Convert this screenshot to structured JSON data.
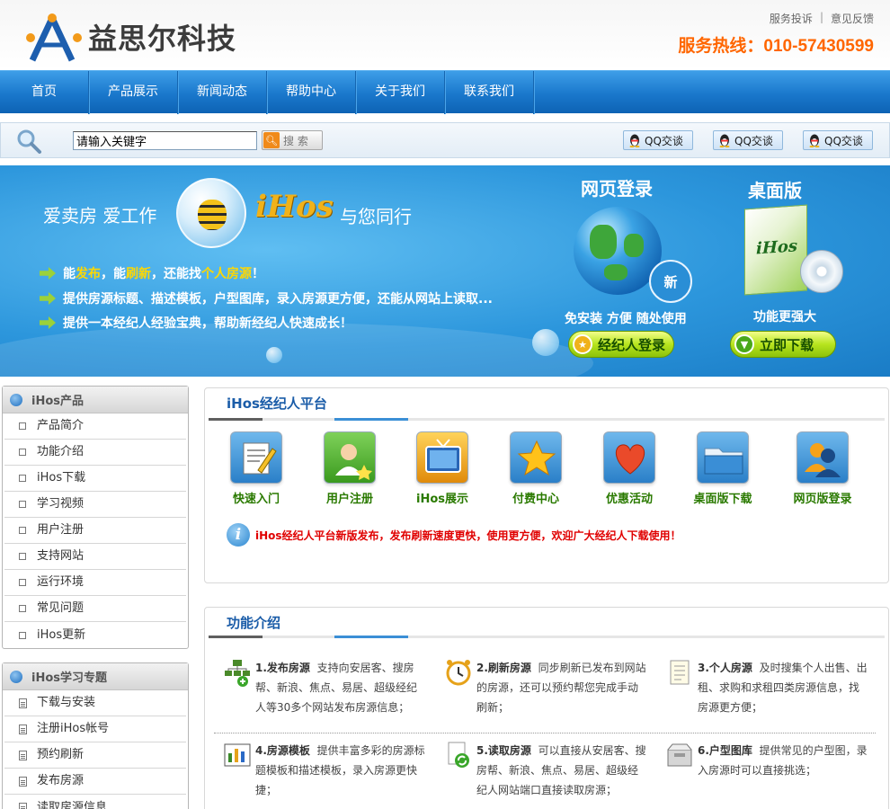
{
  "header": {
    "logo_text": "益思尔科技",
    "top_links": [
      "服务投诉",
      "意见反馈"
    ],
    "top_links_sep": "|",
    "hotline": "服务热线：010-57430599"
  },
  "nav": {
    "items": [
      "首页",
      "产品展示",
      "新闻动态",
      "帮助中心",
      "关于我们",
      "联系我们"
    ]
  },
  "search": {
    "value": "请输入关键字",
    "button_label": "搜 索",
    "qq_buttons": [
      "QQ交谈",
      "QQ交谈",
      "QQ交谈"
    ]
  },
  "banner": {
    "slogan_left": "爱卖房 爱工作",
    "brand": "iHos",
    "slogan_right": "与您同行",
    "feature_1": {
      "p1": "能",
      "h1": "发布",
      "p2": "，能",
      "h2": "刷新",
      "p3": "，还能找",
      "h3": "个人房源",
      "p4": "！"
    },
    "feature_2": "提供房源标题、描述模板，户型图库，录入房源更方便，还能从网站上读取...",
    "feature_3": "提供一本经纪人经验宝典，帮助新经纪人快速成长！",
    "web_title": "网页登录",
    "web_badge": "新",
    "web_sub": "免安装  方便  随处使用",
    "web_button": "经纪人登录",
    "desktop_title": "桌面版",
    "desktop_box_label": "iHos",
    "desktop_sub": "功能更强大",
    "desktop_button": "立即下载"
  },
  "sidebar": {
    "products": {
      "title": "iHos产品",
      "items": [
        "产品简介",
        "功能介绍",
        "iHos下载",
        "学习视频",
        "用户注册",
        "支持网站",
        "运行环境",
        "常见问题",
        "iHos更新"
      ]
    },
    "topics": {
      "title": "iHos学习专题",
      "items": [
        "下载与安装",
        "注册iHos帐号",
        "预约刷新",
        "发布房源",
        "读取房源信息"
      ]
    }
  },
  "platform": {
    "title": "iHos经纪人平台",
    "apps": [
      {
        "label": "快速入门",
        "icon": "notepad-pencil-icon",
        "color": "#3f9ad8"
      },
      {
        "label": "用户注册",
        "icon": "user-register-icon",
        "color": "#4cae2e"
      },
      {
        "label": "iHos展示",
        "icon": "tv-icon",
        "color": "#e59a12"
      },
      {
        "label": "付费中心",
        "icon": "star-icon",
        "color": "#3f9ad8"
      },
      {
        "label": "优惠活动",
        "icon": "heart-icon",
        "color": "#3f9ad8"
      },
      {
        "label": "桌面版下载",
        "icon": "folder-icon",
        "color": "#3f9ad8"
      },
      {
        "label": "网页版登录",
        "icon": "users-icon",
        "color": "#3f9ad8"
      }
    ],
    "notice": "iHos经纪人平台新版发布，发布刷新速度更快，使用更方便，欢迎广大经纪人下载使用！"
  },
  "features": {
    "title": "功能介绍",
    "items": [
      {
        "title": "1.发布房源",
        "desc": "支持向安居客、搜房帮、新浪、焦点、易居、超级经纪人等30多个网站发布房源信息；",
        "icon": "network-publish-icon"
      },
      {
        "title": "2.刷新房源",
        "desc": "同步刷新已发布到网站的房源，还可以预约帮您完成手动刷新；",
        "icon": "alarm-clock-icon"
      },
      {
        "title": "3.个人房源",
        "desc": "及时搜集个人出售、出租、求购和求租四类房源信息，找房源更方便；",
        "icon": "document-list-icon"
      },
      {
        "title": "4.房源模板",
        "desc": "提供丰富多彩的房源标题模板和描述模板，录入房源更快捷；",
        "icon": "chart-template-icon"
      },
      {
        "title": "5.读取房源",
        "desc": "可以直接从安居客、搜房帮、新浪、焦点、易居、超级经纪人网站端口直接读取房源；",
        "icon": "refresh-document-icon"
      },
      {
        "title": "6.户型图库",
        "desc": "提供常见的户型图，录入房源时可以直接挑选；",
        "icon": "floorplan-box-icon"
      }
    ]
  }
}
